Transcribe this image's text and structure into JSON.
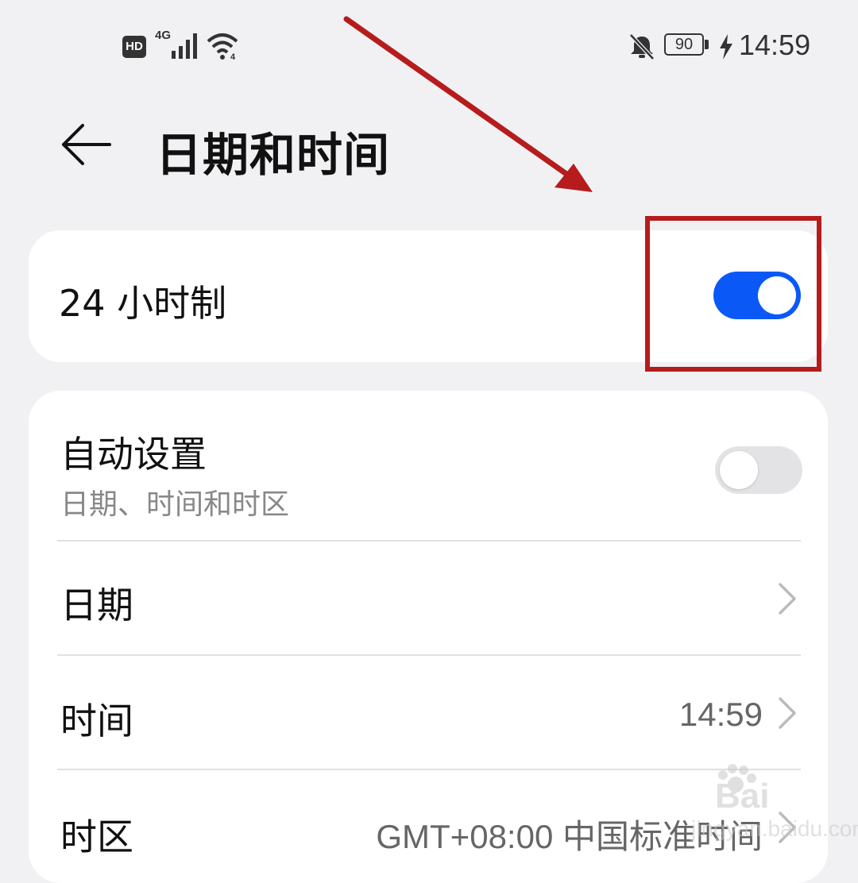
{
  "status_bar": {
    "hd_label": "HD",
    "network_type": "4G",
    "battery_level": "90",
    "time": "14:59"
  },
  "header": {
    "title": "日期和时间"
  },
  "settings": {
    "hour24": {
      "label": "24 小时制",
      "enabled": true
    },
    "auto_set": {
      "label": "自动设置",
      "sublabel": "日期、时间和时区",
      "enabled": false
    },
    "date": {
      "label": "日期"
    },
    "time": {
      "label": "时间",
      "value": "14:59"
    },
    "timezone": {
      "label": "时区",
      "value": "GMT+08:00 中国标准时间"
    }
  },
  "watermark": {
    "brand": "Bai",
    "sub": "jingyan.baidu.com"
  },
  "colors": {
    "accent": "#0a59f7",
    "toggle_off": "#e3e3e5",
    "annotation": "#b61c1c"
  }
}
